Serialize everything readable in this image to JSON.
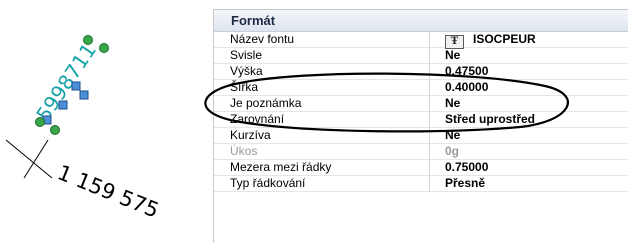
{
  "drawing": {
    "upper_text": "5998711",
    "lower_text": "1 159 575",
    "text_color": "#17a3a8",
    "grip_color": "#4a8fd8",
    "grip_end_color": "#3aa84a"
  },
  "panel": {
    "title": "Formát",
    "rows": [
      {
        "name": "Název fontu",
        "value": "ISOCPEUR",
        "icon": "truetype-font-icon"
      },
      {
        "name": "Svisle",
        "value": "Ne"
      },
      {
        "name": "Výška",
        "value": "0.47500"
      },
      {
        "name": "Šířka",
        "value": "0.40000"
      },
      {
        "name": "Je poznámka",
        "value": "Ne"
      },
      {
        "name": "Zarovnání",
        "value": "Střed uprostřed"
      },
      {
        "name": "Kurzíva",
        "value": "Ne"
      },
      {
        "name": "Úkos",
        "value": "0g",
        "disabled": true
      },
      {
        "name": "Mezera mezi řádky",
        "value": "0.75000"
      },
      {
        "name": "Typ řádkování",
        "value": "Přesně"
      }
    ]
  },
  "annotation_color": "#000000"
}
